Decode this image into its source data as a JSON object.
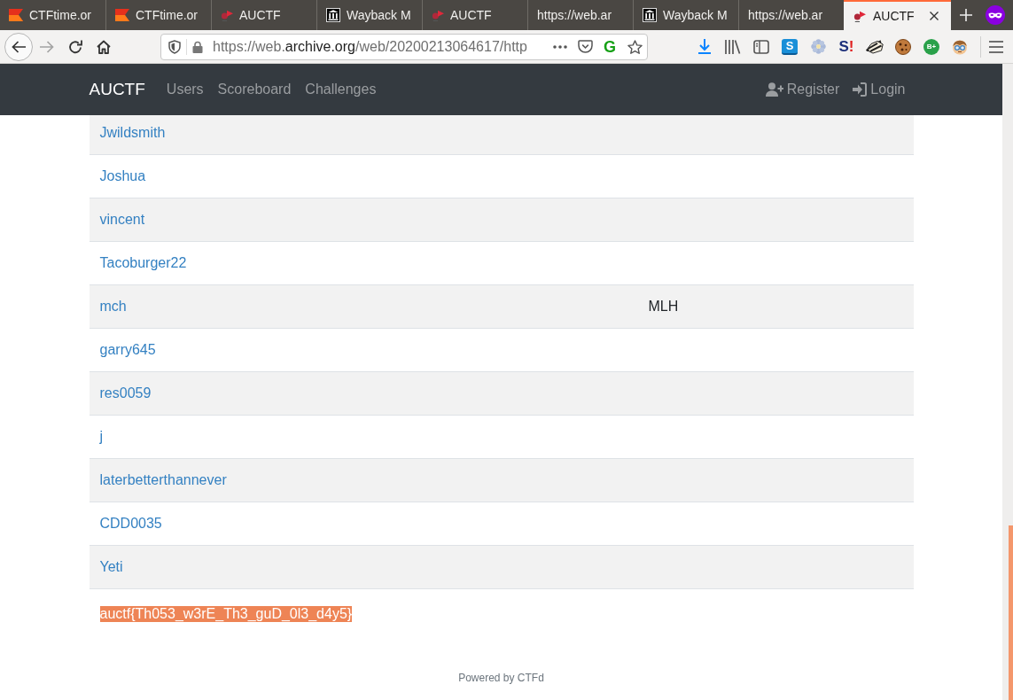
{
  "tabs": [
    {
      "title": "CTFtime.or",
      "kind": "flag",
      "selected": false
    },
    {
      "title": "CTFtime.or",
      "kind": "flag",
      "selected": false
    },
    {
      "title": "AUCTF",
      "kind": "pennant",
      "selected": false
    },
    {
      "title": "Wayback M",
      "kind": "columns",
      "selected": false
    },
    {
      "title": "AUCTF",
      "kind": "pennant",
      "selected": false
    },
    {
      "title": "https://web.ar",
      "kind": "plain",
      "selected": false
    },
    {
      "title": "Wayback M",
      "kind": "columns",
      "selected": false
    },
    {
      "title": "https://web.ar",
      "kind": "plain",
      "selected": false
    },
    {
      "title": "AUCTF",
      "kind": "pennant",
      "selected": true
    }
  ],
  "nav_buttons": [
    {
      "kind": "back",
      "disabled": false
    },
    {
      "kind": "forward",
      "disabled": true
    },
    {
      "kind": "reload",
      "disabled": false
    },
    {
      "kind": "home",
      "disabled": false
    }
  ],
  "address_bar": {
    "url_start": "https://web.",
    "url_host": "archive.org",
    "url_end": "/web/20200213064617/http",
    "actions": [
      {
        "kind": "more"
      },
      {
        "kind": "pocket"
      },
      {
        "kind": "letter",
        "text": "G"
      },
      {
        "kind": "star"
      }
    ]
  },
  "toolbar_icons": [
    {
      "kind": "download"
    },
    {
      "kind": "library"
    },
    {
      "kind": "sidebar"
    },
    {
      "kind": "tile",
      "text": "S"
    },
    {
      "kind": "flower"
    },
    {
      "kind": "mark",
      "text": "S!"
    },
    {
      "kind": "badger"
    },
    {
      "kind": "cookie"
    },
    {
      "kind": "disc",
      "text": "B+"
    },
    {
      "kind": "face"
    }
  ],
  "navbar": {
    "brand": "AUCTF",
    "links": [
      {
        "label": "Users"
      },
      {
        "label": "Scoreboard"
      },
      {
        "label": "Challenges"
      }
    ],
    "account_links": [
      {
        "label": "Register",
        "kind": "register"
      },
      {
        "label": "Login",
        "kind": "login"
      }
    ]
  },
  "table": {
    "rows": [
      {
        "column_1": "Jwildsmith"
      },
      {
        "column_1": "Joshua"
      },
      {
        "column_1": "vincent"
      },
      {
        "column_1": "Tacoburger22"
      },
      {
        "column_1": "mch",
        "column_2": "MLH"
      },
      {
        "column_1": "garry645"
      },
      {
        "column_1": "res0059"
      },
      {
        "column_1": "j"
      },
      {
        "column_1": "laterbetterthannever"
      },
      {
        "column_1": "CDD0035"
      },
      {
        "column_1": "Yeti"
      }
    ]
  },
  "flag": {
    "text": "auctf{Th053_w3rE_Th3_guD_0l3_d4y5}",
    "highlighted": true
  },
  "footer": "Powered by CTFd"
}
